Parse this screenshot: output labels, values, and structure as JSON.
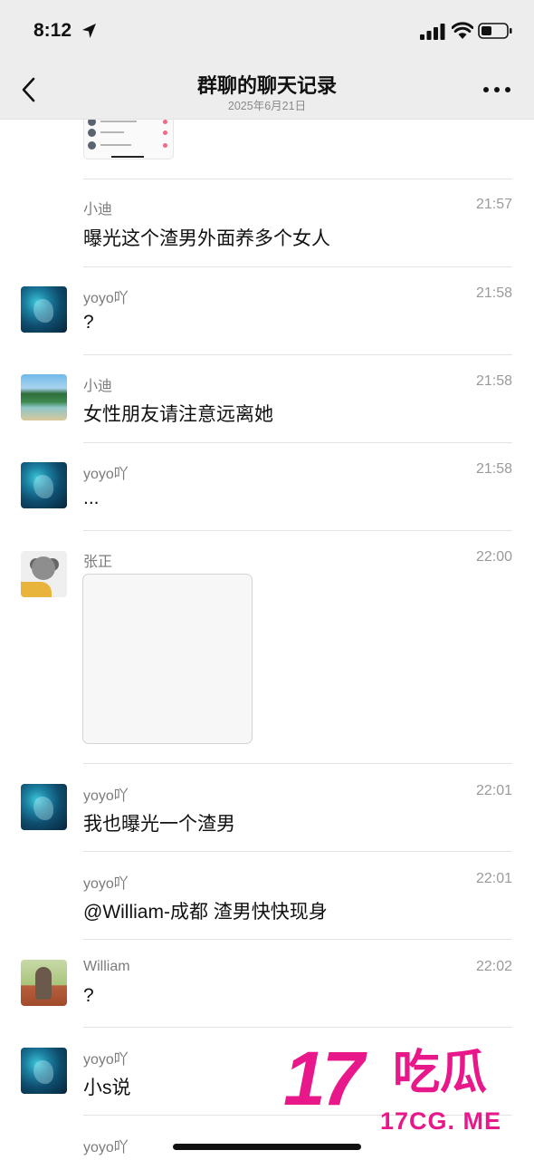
{
  "status_bar": {
    "time": "8:12"
  },
  "header": {
    "title": "群聊的聊天记录",
    "subtitle": "2025年6月21日"
  },
  "messages": [
    {
      "sender": "小迪",
      "time": "21:57",
      "text": "曝光这个渣男外面养多个女人"
    },
    {
      "sender": "yoyo吖",
      "time": "21:58",
      "text": "?"
    },
    {
      "sender": "小迪",
      "time": "21:58",
      "text": "女性朋友请注意远离她"
    },
    {
      "sender": "yoyo吖",
      "time": "21:58",
      "text": "..."
    },
    {
      "sender": "张正",
      "time": "22:00"
    },
    {
      "sender": "yoyo吖",
      "time": "22:01",
      "text": "我也曝光一个渣男"
    },
    {
      "sender": "yoyo吖",
      "time": "22:01",
      "text": "@William-成都 渣男快快现身"
    },
    {
      "sender": "William",
      "time": "22:02",
      "text": "?"
    },
    {
      "sender": "yoyo吖",
      "text": "小s说"
    },
    {
      "sender": "yoyo吖"
    }
  ],
  "watermark": {
    "number": "17",
    "name": "吃瓜",
    "site": "17CG. ME"
  },
  "colors": {
    "background": "#ffffff",
    "header_bg": "#ededed",
    "watermark": "#e8188a"
  },
  "icons": [
    "location-arrow-icon",
    "signal-icon",
    "wifi-icon",
    "battery-icon",
    "back-chevron-icon",
    "more-dots-icon"
  ]
}
